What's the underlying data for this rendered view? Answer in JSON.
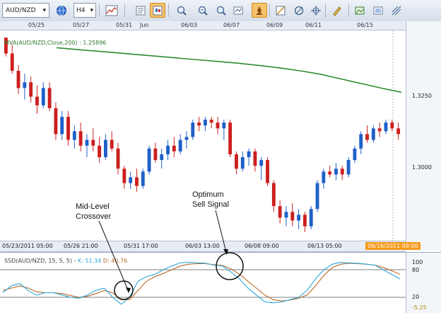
{
  "toolbar": {
    "symbol": "AUD/NZD",
    "timeframe": "H4",
    "icons": [
      "globe-icon",
      "line-chart-icon",
      "properties-icon",
      "chart-type-icon",
      "zoom-in-icon",
      "zoom-out-icon",
      "zoom-search-icon",
      "marker-icon",
      "trendline-icon",
      "draw-icon",
      "pencil-icon",
      "picture-icon",
      "picture-box-icon",
      "fibonacci-icon"
    ]
  },
  "top_dates": [
    "05/25",
    "05/27",
    "05/31",
    "Jun",
    "06/03",
    "06/07",
    "06/09",
    "06/11",
    "06/15"
  ],
  "bottom_dates": [
    "05/23/2011 05:00",
    "05/26 21:00",
    "05/31 17:00",
    "06/03 13:00",
    "06/08 09:00",
    "06/13 05:00"
  ],
  "current_date": "06/16/2011 09:00",
  "price_labels": [
    "1.3250",
    "1.3000"
  ],
  "ma_label": "MVA(AUD/NZD,Close,200) : 1.25896",
  "ssd": {
    "label_prefix": "SSD(AUD/NZD, 15, 5, 5) -",
    "k_label": "K: 51.34",
    "d_label": "D: 40.76",
    "levels": [
      "100",
      "80",
      "20",
      "-5.25"
    ]
  },
  "annotations": {
    "mid_level": [
      "Mid-Level",
      "Crossover"
    ],
    "optimum": [
      "Optimum",
      "Sell Signal"
    ]
  },
  "colors": {
    "bull": "#1f5fc8",
    "bear": "#cc1f1f",
    "ma": "#2e8b2e",
    "k_line": "#2ca7d8",
    "d_line": "#b86a2a",
    "accent": "#f59a1c"
  },
  "chart_data": {
    "type": "candlestick",
    "series": [
      {
        "name": "AUD/NZD",
        "values": [
          {
            "o": 1.3455,
            "h": 1.344,
            "l": 1.339,
            "c": 1.34
          },
          {
            "o": 1.34,
            "h": 1.343,
            "l": 1.333,
            "c": 1.334
          },
          {
            "o": 1.334,
            "h": 1.336,
            "l": 1.326,
            "c": 1.328
          },
          {
            "o": 1.328,
            "h": 1.333,
            "l": 1.324,
            "c": 1.33
          },
          {
            "o": 1.33,
            "h": 1.332,
            "l": 1.323,
            "c": 1.325
          },
          {
            "o": 1.325,
            "h": 1.329,
            "l": 1.319,
            "c": 1.322
          },
          {
            "o": 1.322,
            "h": 1.33,
            "l": 1.321,
            "c": 1.328
          },
          {
            "o": 1.328,
            "h": 1.33,
            "l": 1.32,
            "c": 1.321
          },
          {
            "o": 1.321,
            "h": 1.323,
            "l": 1.31,
            "c": 1.312
          },
          {
            "o": 1.312,
            "h": 1.32,
            "l": 1.31,
            "c": 1.318
          },
          {
            "o": 1.318,
            "h": 1.32,
            "l": 1.308,
            "c": 1.31
          },
          {
            "o": 1.31,
            "h": 1.315,
            "l": 1.307,
            "c": 1.313
          },
          {
            "o": 1.313,
            "h": 1.316,
            "l": 1.306,
            "c": 1.308
          },
          {
            "o": 1.308,
            "h": 1.312,
            "l": 1.304,
            "c": 1.31
          },
          {
            "o": 1.31,
            "h": 1.314,
            "l": 1.306,
            "c": 1.308
          },
          {
            "o": 1.308,
            "h": 1.311,
            "l": 1.302,
            "c": 1.304
          },
          {
            "o": 1.304,
            "h": 1.312,
            "l": 1.303,
            "c": 1.31
          },
          {
            "o": 1.31,
            "h": 1.313,
            "l": 1.306,
            "c": 1.307
          },
          {
            "o": 1.307,
            "h": 1.309,
            "l": 1.298,
            "c": 1.3
          },
          {
            "o": 1.3,
            "h": 1.301,
            "l": 1.293,
            "c": 1.295
          },
          {
            "o": 1.295,
            "h": 1.299,
            "l": 1.293,
            "c": 1.297
          },
          {
            "o": 1.297,
            "h": 1.3,
            "l": 1.292,
            "c": 1.294
          },
          {
            "o": 1.294,
            "h": 1.3,
            "l": 1.293,
            "c": 1.299
          },
          {
            "o": 1.299,
            "h": 1.308,
            "l": 1.298,
            "c": 1.307
          },
          {
            "o": 1.307,
            "h": 1.309,
            "l": 1.302,
            "c": 1.303
          },
          {
            "o": 1.303,
            "h": 1.307,
            "l": 1.3,
            "c": 1.305
          },
          {
            "o": 1.305,
            "h": 1.31,
            "l": 1.303,
            "c": 1.308
          },
          {
            "o": 1.308,
            "h": 1.311,
            "l": 1.304,
            "c": 1.306
          },
          {
            "o": 1.306,
            "h": 1.312,
            "l": 1.305,
            "c": 1.31
          },
          {
            "o": 1.31,
            "h": 1.313,
            "l": 1.307,
            "c": 1.311
          },
          {
            "o": 1.311,
            "h": 1.317,
            "l": 1.31,
            "c": 1.316
          },
          {
            "o": 1.316,
            "h": 1.318,
            "l": 1.313,
            "c": 1.315
          },
          {
            "o": 1.315,
            "h": 1.318,
            "l": 1.313,
            "c": 1.317
          },
          {
            "o": 1.317,
            "h": 1.318,
            "l": 1.314,
            "c": 1.316
          },
          {
            "o": 1.316,
            "h": 1.318,
            "l": 1.312,
            "c": 1.314
          },
          {
            "o": 1.314,
            "h": 1.317,
            "l": 1.31,
            "c": 1.316
          },
          {
            "o": 1.316,
            "h": 1.317,
            "l": 1.304,
            "c": 1.305
          },
          {
            "o": 1.305,
            "h": 1.306,
            "l": 1.298,
            "c": 1.3
          },
          {
            "o": 1.3,
            "h": 1.306,
            "l": 1.299,
            "c": 1.304
          },
          {
            "o": 1.304,
            "h": 1.307,
            "l": 1.301,
            "c": 1.306
          },
          {
            "o": 1.306,
            "h": 1.307,
            "l": 1.299,
            "c": 1.301
          },
          {
            "o": 1.301,
            "h": 1.304,
            "l": 1.296,
            "c": 1.303
          },
          {
            "o": 1.303,
            "h": 1.304,
            "l": 1.294,
            "c": 1.295
          },
          {
            "o": 1.295,
            "h": 1.296,
            "l": 1.285,
            "c": 1.287
          },
          {
            "o": 1.287,
            "h": 1.289,
            "l": 1.281,
            "c": 1.283
          },
          {
            "o": 1.283,
            "h": 1.287,
            "l": 1.28,
            "c": 1.285
          },
          {
            "o": 1.285,
            "h": 1.288,
            "l": 1.28,
            "c": 1.282
          },
          {
            "o": 1.282,
            "h": 1.286,
            "l": 1.279,
            "c": 1.284
          },
          {
            "o": 1.284,
            "h": 1.285,
            "l": 1.278,
            "c": 1.28
          },
          {
            "o": 1.28,
            "h": 1.287,
            "l": 1.279,
            "c": 1.286
          },
          {
            "o": 1.286,
            "h": 1.296,
            "l": 1.285,
            "c": 1.295
          },
          {
            "o": 1.295,
            "h": 1.3,
            "l": 1.293,
            "c": 1.299
          },
          {
            "o": 1.299,
            "h": 1.301,
            "l": 1.297,
            "c": 1.298
          },
          {
            "o": 1.298,
            "h": 1.302,
            "l": 1.296,
            "c": 1.3
          },
          {
            "o": 1.3,
            "h": 1.301,
            "l": 1.296,
            "c": 1.298
          },
          {
            "o": 1.298,
            "h": 1.304,
            "l": 1.297,
            "c": 1.303
          },
          {
            "o": 1.303,
            "h": 1.308,
            "l": 1.302,
            "c": 1.307
          },
          {
            "o": 1.307,
            "h": 1.313,
            "l": 1.305,
            "c": 1.312
          },
          {
            "o": 1.312,
            "h": 1.315,
            "l": 1.309,
            "c": 1.31
          },
          {
            "o": 1.31,
            "h": 1.315,
            "l": 1.309,
            "c": 1.314
          },
          {
            "o": 1.314,
            "h": 1.316,
            "l": 1.311,
            "c": 1.313
          },
          {
            "o": 1.313,
            "h": 1.317,
            "l": 1.312,
            "c": 1.316
          },
          {
            "o": 1.316,
            "h": 1.317,
            "l": 1.313,
            "c": 1.314
          },
          {
            "o": 1.314,
            "h": 1.316,
            "l": 1.31,
            "c": 1.312
          }
        ]
      },
      {
        "name": "MVA(AUD/NZD,Close,200)",
        "values": [
          1.342,
          1.3414,
          1.3408,
          1.3402,
          1.3396,
          1.339,
          1.3384,
          1.3378,
          1.3372,
          1.3366,
          1.3358,
          1.335,
          1.334,
          1.3328,
          1.3312,
          1.3296,
          1.328,
          1.3265
        ]
      },
      {
        "name": "K",
        "values": [
          30,
          45,
          50,
          35,
          25,
          30,
          30,
          25,
          20,
          18,
          25,
          35,
          40,
          20,
          5,
          20,
          55,
          65,
          70,
          80,
          88,
          95,
          96,
          95,
          94,
          90,
          88,
          75,
          60,
          40,
          25,
          10,
          8,
          10,
          15,
          20,
          35,
          60,
          80,
          92,
          96,
          95,
          94,
          92,
          90,
          80,
          70,
          60
        ]
      },
      {
        "name": "D",
        "values": [
          35,
          40,
          45,
          40,
          32,
          30,
          30,
          28,
          24,
          20,
          22,
          28,
          35,
          30,
          15,
          15,
          35,
          55,
          65,
          72,
          80,
          88,
          92,
          93,
          93,
          91,
          89,
          82,
          70,
          55,
          40,
          25,
          15,
          12,
          14,
          18,
          25,
          45,
          68,
          85,
          92,
          94,
          93,
          92,
          90,
          85,
          78,
          70
        ]
      }
    ],
    "ylim": [
      1.275,
      1.348
    ],
    "levels": [
      100,
      80,
      20
    ]
  }
}
